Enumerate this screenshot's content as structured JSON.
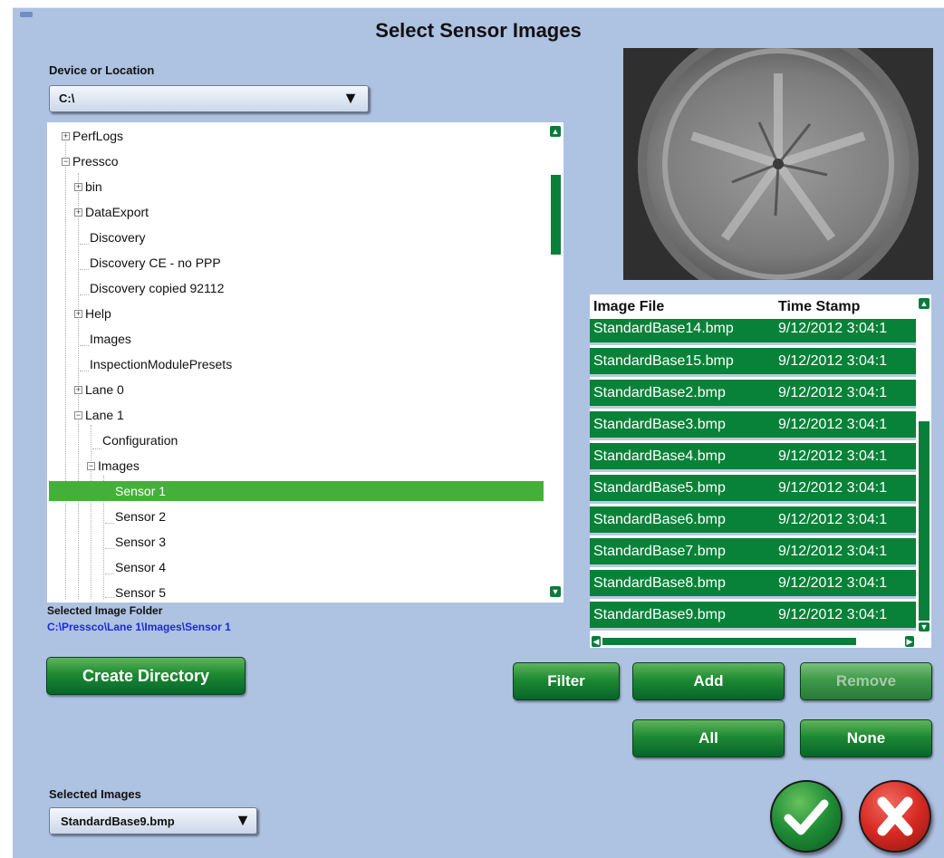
{
  "dialog": {
    "title": "Select Sensor Images"
  },
  "device": {
    "label": "Device or Location",
    "value": "C:\\"
  },
  "tree": {
    "nodes": [
      {
        "label": "PerfLogs",
        "expander": "+"
      },
      {
        "label": "Pressco",
        "expander": "−"
      },
      {
        "label": "bin",
        "expander": "+"
      },
      {
        "label": "DataExport",
        "expander": "+"
      },
      {
        "label": "Discovery",
        "expander": ""
      },
      {
        "label": "Discovery CE - no PPP",
        "expander": ""
      },
      {
        "label": "Discovery copied 92112",
        "expander": ""
      },
      {
        "label": "Help",
        "expander": "+"
      },
      {
        "label": "Images",
        "expander": ""
      },
      {
        "label": "InspectionModulePresets",
        "expander": ""
      },
      {
        "label": "Lane 0",
        "expander": "+"
      },
      {
        "label": "Lane 1",
        "expander": "−"
      },
      {
        "label": "Configuration",
        "expander": ""
      },
      {
        "label": "Images",
        "expander": "−"
      },
      {
        "label": "Sensor 1",
        "expander": ""
      },
      {
        "label": "Sensor 2",
        "expander": ""
      },
      {
        "label": "Sensor 3",
        "expander": ""
      },
      {
        "label": "Sensor 4",
        "expander": ""
      },
      {
        "label": "Sensor 5",
        "expander": ""
      }
    ],
    "selected": "Sensor 1"
  },
  "selected_folder": {
    "label": "Selected Image Folder",
    "path": "C:\\Pressco\\Lane 1\\Images\\Sensor 1"
  },
  "file_list": {
    "headers": [
      "Image File",
      "Time Stamp"
    ],
    "rows": [
      {
        "file": "StandardBase14.bmp",
        "time": "9/12/2012 3:04:1"
      },
      {
        "file": "StandardBase15.bmp",
        "time": "9/12/2012 3:04:1"
      },
      {
        "file": "StandardBase2.bmp",
        "time": "9/12/2012 3:04:1"
      },
      {
        "file": "StandardBase3.bmp",
        "time": "9/12/2012 3:04:1"
      },
      {
        "file": "StandardBase4.bmp",
        "time": "9/12/2012 3:04:1"
      },
      {
        "file": "StandardBase5.bmp",
        "time": "9/12/2012 3:04:1"
      },
      {
        "file": "StandardBase6.bmp",
        "time": "9/12/2012 3:04:1"
      },
      {
        "file": "StandardBase7.bmp",
        "time": "9/12/2012 3:04:1"
      },
      {
        "file": "StandardBase8.bmp",
        "time": "9/12/2012 3:04:1"
      },
      {
        "file": "StandardBase9.bmp",
        "time": "9/12/2012 3:04:1"
      }
    ]
  },
  "buttons": {
    "create_directory": "Create Directory",
    "filter": "Filter",
    "add": "Add",
    "remove": "Remove",
    "all": "All",
    "none": "None"
  },
  "selected_images": {
    "label": "Selected Images",
    "value": "StandardBase9.bmp"
  },
  "icons": {
    "ok": "checkmark-icon",
    "cancel": "x-icon",
    "dropdown": "triangle-down-icon",
    "expand": "plus-box-icon",
    "collapse": "minus-box-icon"
  },
  "colors": {
    "background": "#aec2e2",
    "accent_green": "#078238",
    "selection_green": "#45b039",
    "path_blue": "#1c2bd6",
    "cancel_red": "#d62a23"
  }
}
